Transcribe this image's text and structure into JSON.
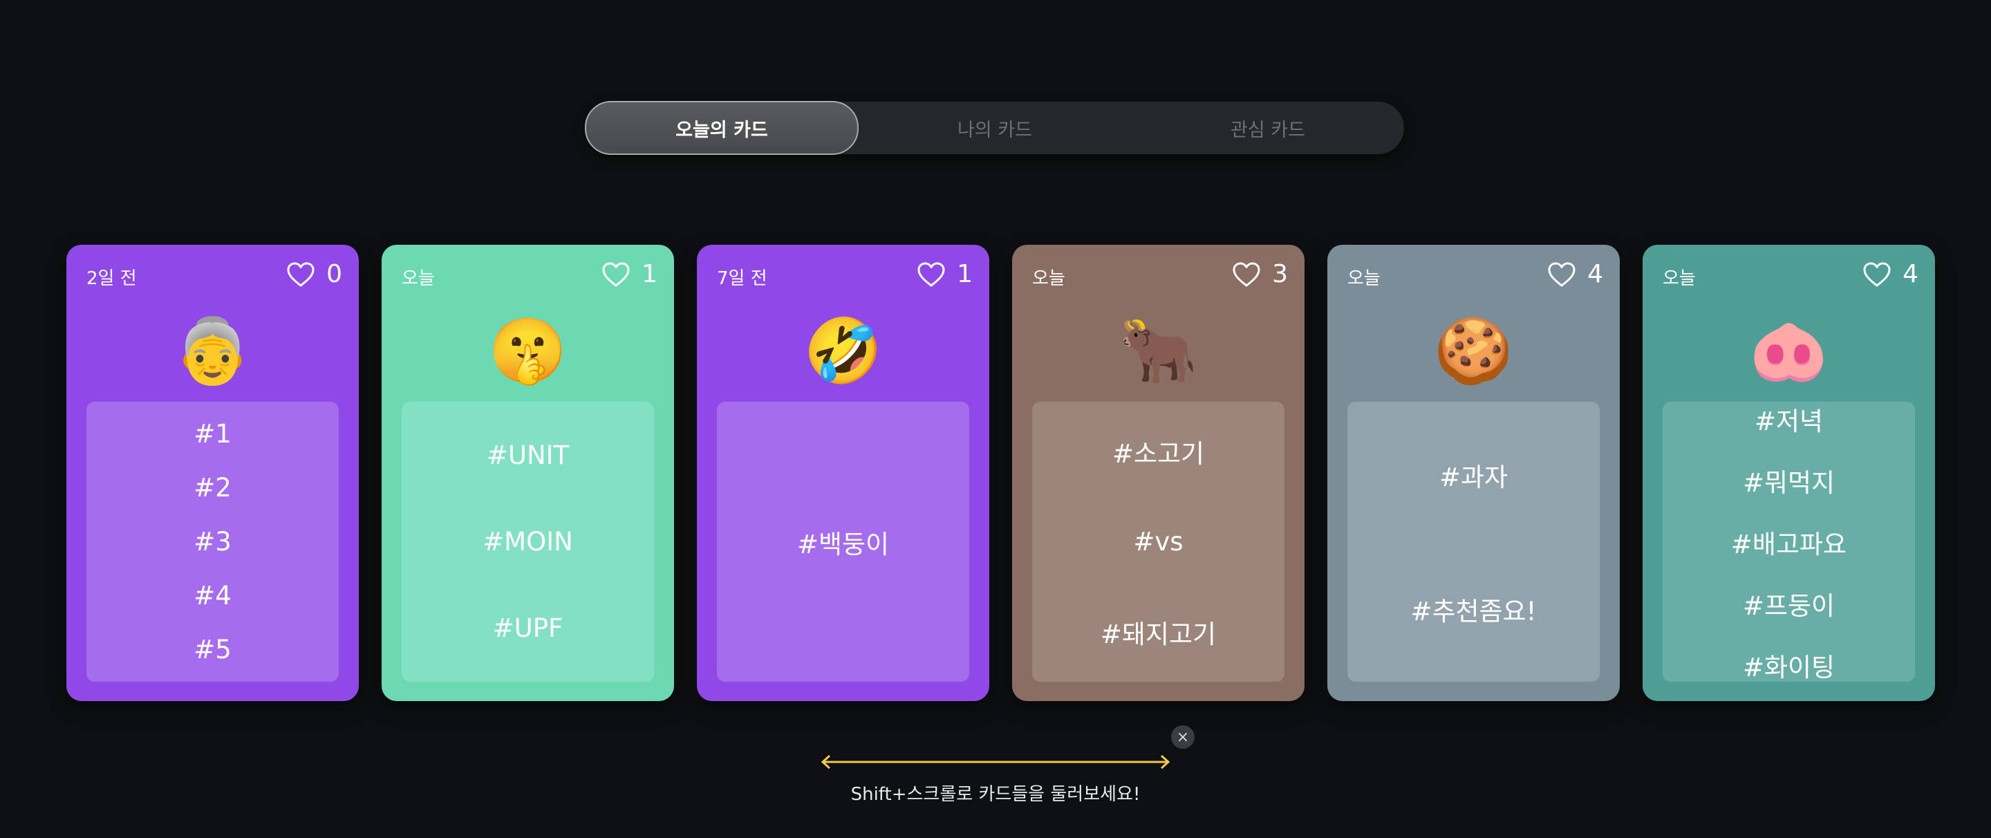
{
  "tabs": [
    {
      "label": "오늘의 카드",
      "active": true
    },
    {
      "label": "나의 카드",
      "active": false
    },
    {
      "label": "관심 카드",
      "active": false
    }
  ],
  "cards": [
    {
      "date": "2일 전",
      "likes": "0",
      "emoji": "👵",
      "emoji_name": "older-woman-santa-icon",
      "color": "#9049e6",
      "box": "#a56ded",
      "tags": [
        "#1",
        "#2",
        "#3",
        "#4",
        "#5"
      ]
    },
    {
      "date": "오늘",
      "likes": "1",
      "emoji": "🤫",
      "emoji_name": "shushing-face-icon",
      "color": "#6dd9b3",
      "box": "#84e0c2",
      "tags": [
        "#UNIT",
        "#MOIN",
        "#UPF"
      ]
    },
    {
      "date": "7일 전",
      "likes": "1",
      "emoji": "🤣",
      "emoji_name": "rolling-laughing-face-icon",
      "color": "#9049e6",
      "box": "#a56ded",
      "tags": [
        "#백둥이"
      ]
    },
    {
      "date": "오늘",
      "likes": "3",
      "emoji": "🐂",
      "emoji_name": "ox-icon",
      "color": "#8a6e64",
      "box": "#9c857b",
      "tags": [
        "#소고기",
        "#vs",
        "#돼지고기"
      ]
    },
    {
      "date": "오늘",
      "likes": "4",
      "emoji": "🍪",
      "emoji_name": "cookie-icon",
      "color": "#7a8d98",
      "box": "#93a3ad",
      "tags": [
        "#과자",
        "#추천좀요!"
      ]
    },
    {
      "date": "오늘",
      "likes": "4",
      "emoji": "🐽",
      "emoji_name": "pig-nose-icon",
      "color": "#4f9e95",
      "box": "#68aea6",
      "tags": [
        "#저녁",
        "#뭐먹지",
        "#배고파요",
        "#프둥이",
        "#화이팅"
      ]
    }
  ],
  "hint": {
    "text": "Shift+스크롤로 카드들을 둘러보세요!",
    "close_symbol": "×",
    "arrow_color": "#f2c94c"
  }
}
